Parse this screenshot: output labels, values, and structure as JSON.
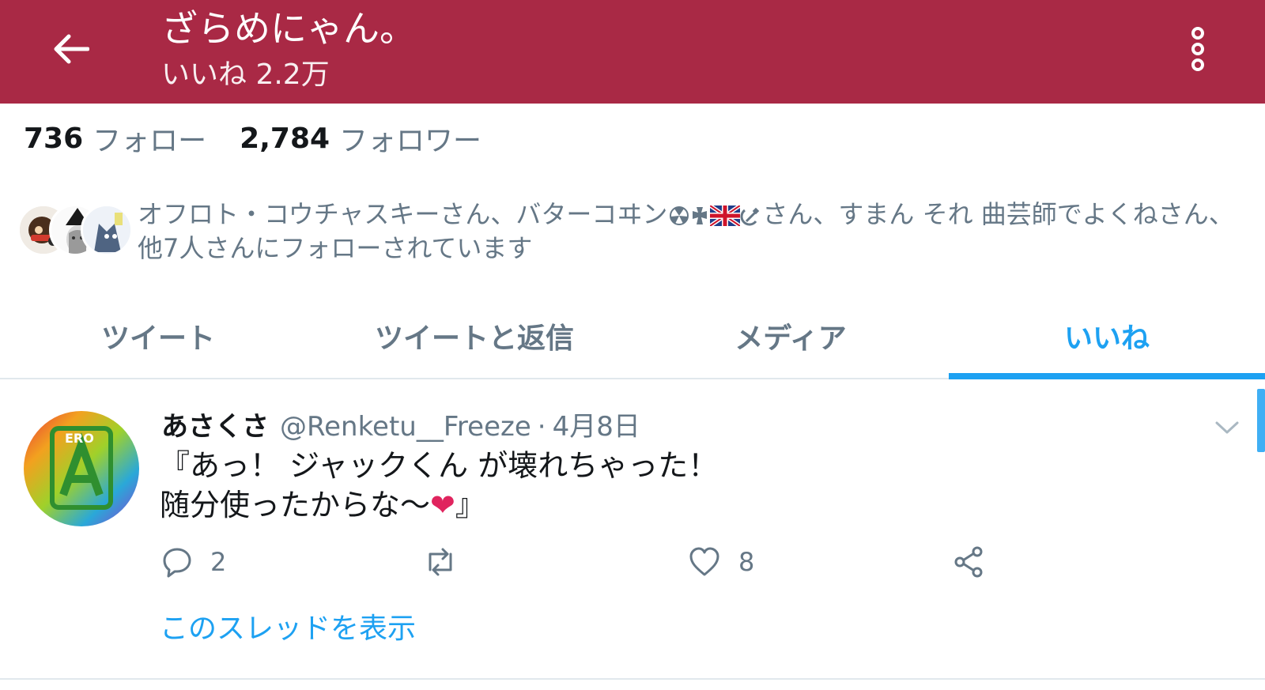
{
  "header": {
    "title": "ざらめにゃん。",
    "subtitle": "いいね 2.2万",
    "back_icon": "arrow-left-icon",
    "more_icon": "more-vertical-icon",
    "background_color": "#a92945"
  },
  "stats": {
    "following_count": "736",
    "following_label": "フォロー",
    "followers_count": "2,784",
    "followers_label": "フォロワー"
  },
  "followers_you_know": {
    "text_part1": "オフロト・コウチャスキーさん、バターコヰン",
    "text_part2": "さん、すまん それ 曲芸師でよくねさん、他7人さんにフォローされています"
  },
  "tabs": [
    {
      "label": "ツイート",
      "active": false
    },
    {
      "label": "ツイートと返信",
      "active": false
    },
    {
      "label": "メディア",
      "active": false
    },
    {
      "label": "いいね",
      "active": true
    }
  ],
  "tweet": {
    "name": "あさくさ",
    "handle": "@Renketu__Freeze",
    "separator": "·",
    "date": "4月8日",
    "text_line1": "『あっ！ ジャックくん が壊れちゃった！",
    "text_line2_before": "随分使ったからな〜",
    "text_line2_emoji": "❤",
    "text_line2_after": "』",
    "reply_count": "2",
    "retweet_count": "",
    "like_count": "8",
    "show_thread": "このスレッドを表示"
  },
  "colors": {
    "accent": "#1da1f2",
    "secondary_text": "#657786",
    "divider": "#e1e8ed"
  }
}
